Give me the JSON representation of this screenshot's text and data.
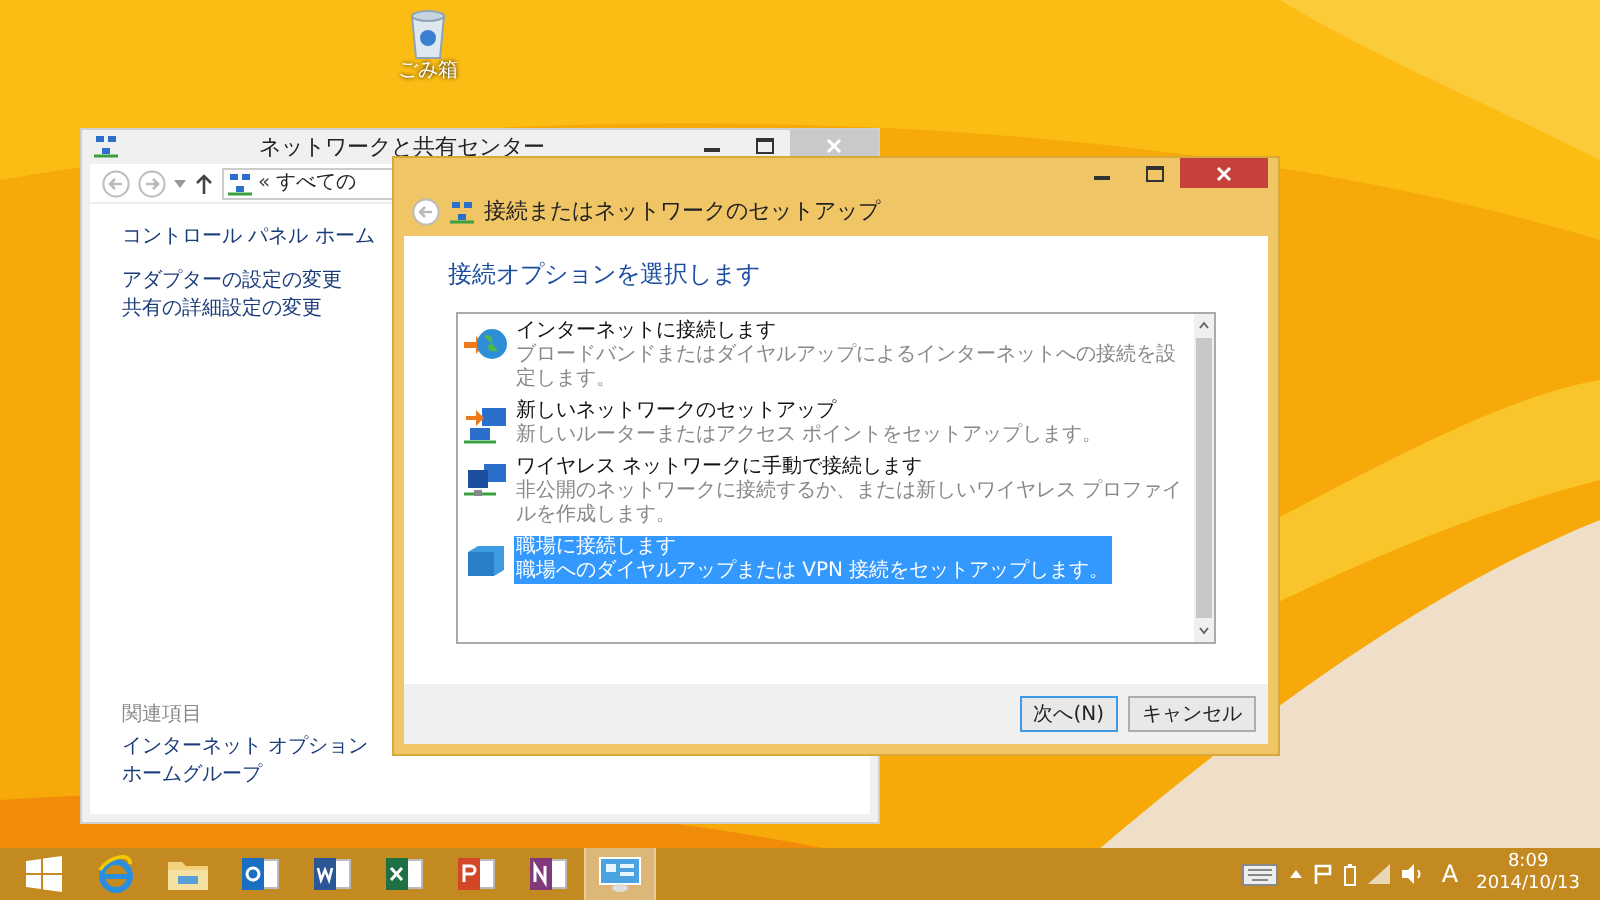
{
  "desktop_icons": [
    {
      "label": "ごみ箱"
    }
  ],
  "back_window": {
    "title": "ネットワークと共有センター",
    "breadcrumb_separator": "«",
    "address": "すべての",
    "sidebar_links": [
      "コントロール パネル ホーム",
      "アダプターの設定の変更",
      "共有の詳細設定の変更"
    ],
    "related_heading": "関連項目",
    "related_links": [
      "インターネット オプション",
      "ホームグループ"
    ]
  },
  "dialog": {
    "title": "接続またはネットワークのセットアップ",
    "heading": "接続オプションを選択します",
    "options": [
      {
        "kind": "internet",
        "title": "インターネットに接続します",
        "description": "ブロードバンドまたはダイヤルアップによるインターネットへの接続を設定します。",
        "selected": false
      },
      {
        "kind": "network",
        "title": "新しいネットワークのセットアップ",
        "description": "新しいルーターまたはアクセス ポイントをセットアップします。",
        "selected": false
      },
      {
        "kind": "wireless",
        "title": "ワイヤレス ネットワークに手動で接続します",
        "description": "非公開のネットワークに接続するか、または新しいワイヤレス プロファイルを作成します。",
        "selected": false
      },
      {
        "kind": "workplace",
        "title": "職場に接続します",
        "description": "職場へのダイヤルアップまたは VPN 接続をセットアップします。",
        "selected": true
      }
    ],
    "buttons": [
      {
        "label": "次へ(N)",
        "default": true
      },
      {
        "label": "キャンセル",
        "default": false
      }
    ]
  },
  "taskbar": {
    "apps": [
      {
        "kind": "start",
        "active": false
      },
      {
        "kind": "browser",
        "active": false
      },
      {
        "kind": "folder",
        "active": false
      },
      {
        "kind": "mail",
        "active": false
      },
      {
        "kind": "document",
        "active": false
      },
      {
        "kind": "spreadsheet",
        "active": false
      },
      {
        "kind": "presentation",
        "active": false
      },
      {
        "kind": "notebook",
        "active": false
      },
      {
        "kind": "network",
        "active": true
      }
    ],
    "ime": "A",
    "time": "8:09",
    "date": "2014/10/13"
  }
}
